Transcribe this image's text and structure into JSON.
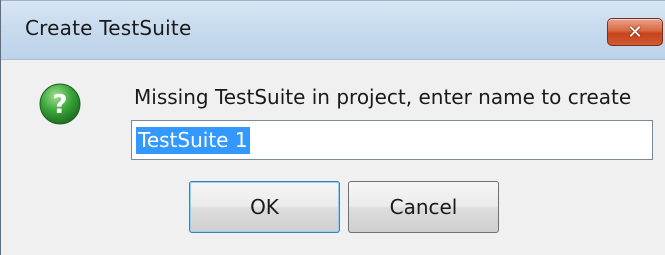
{
  "dialog": {
    "title": "Create TestSuite",
    "close_symbol": "✕",
    "icon": "question-icon",
    "message": "Missing TestSuite in project, enter name to create",
    "input_value": "TestSuite 1",
    "ok_label": "OK",
    "cancel_label": "Cancel"
  },
  "colors": {
    "titlebar": "#c8dbee",
    "close_button": "#c8431b",
    "selection": "#3399ff",
    "icon_green": "#3aa53a"
  }
}
